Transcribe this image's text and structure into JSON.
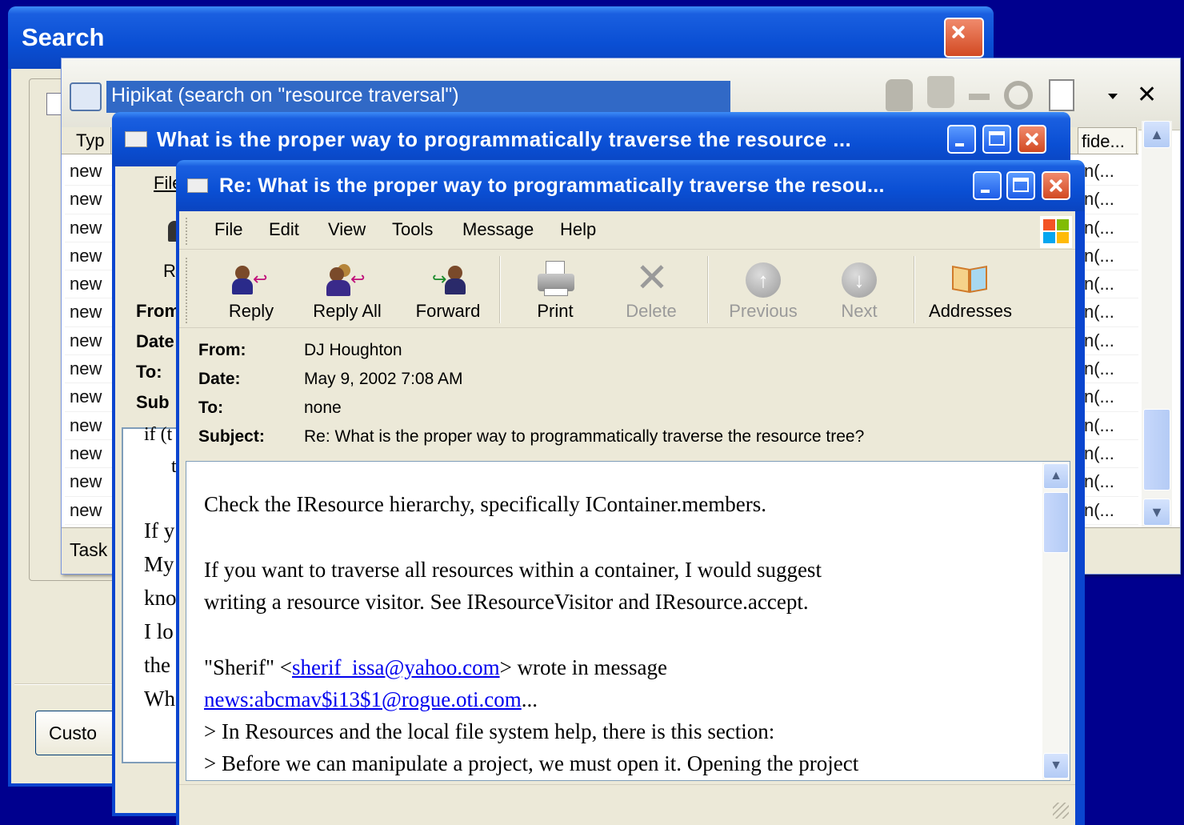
{
  "search_window": {
    "title": "Search",
    "custom_button": "Custo"
  },
  "hipikat_window": {
    "title": "Hipikat (search on \"resource traversal\")",
    "col_type": "Typ",
    "col_confidence": "fide...",
    "row_label": "new",
    "row_trunc": "n(...",
    "tasks_label": "Task"
  },
  "message_back": {
    "title": "What is the proper way to programmatically traverse the resource ...",
    "menu_file": "File",
    "reply_stub": "R",
    "labels": [
      "From",
      "Date",
      "To:",
      "Sub"
    ],
    "body_lines": [
      "if (t",
      "t",
      "If y",
      "My",
      "kno",
      "I lo",
      "the",
      "Wh"
    ]
  },
  "message_front": {
    "title": "Re: What is the proper way to programmatically traverse the resou...",
    "menu": [
      "File",
      "Edit",
      "View",
      "Tools",
      "Message",
      "Help"
    ],
    "toolbar": {
      "reply": "Reply",
      "reply_all": "Reply All",
      "forward": "Forward",
      "print": "Print",
      "delete": "Delete",
      "previous": "Previous",
      "next": "Next",
      "addresses": "Addresses"
    },
    "header": {
      "from_label": "From:",
      "from_value": "DJ Houghton",
      "date_label": "Date:",
      "date_value": "May 9, 2002 7:08 AM",
      "to_label": "To:",
      "to_value": "none",
      "subject_label": "Subject:",
      "subject_value": "Re: What is the proper way to programmatically traverse the resource tree?"
    },
    "body": {
      "p1": "Check the IResource hierarchy, specifically IContainer.members.",
      "p2a": "If you want to traverse all resources within a container, I would suggest",
      "p2b": "writing a resource visitor. See IResourceVisitor and IResource.accept.",
      "quote_name": "\"Sherif\" <",
      "quote_email": "sherif_issa@yahoo.com",
      "quote_after": "> wrote in message",
      "news_link": "news:abcmav$i13$1@rogue.oti.com",
      "news_after": "...",
      "q1": "> In Resources and the local file system help, there is this section:",
      "q2": "> Before we can manipulate a project, we must open it. Opening the project"
    }
  }
}
